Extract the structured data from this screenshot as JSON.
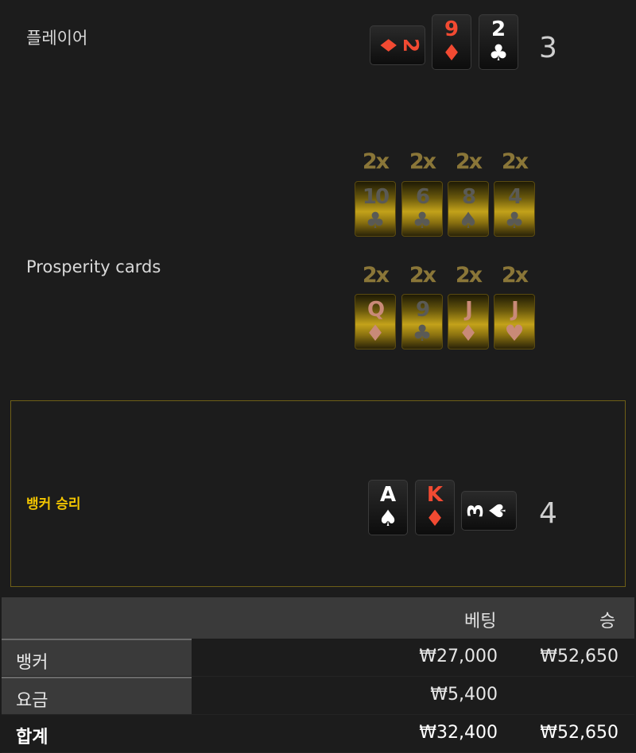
{
  "player": {
    "label": "플레이어",
    "score": "3",
    "cards": [
      {
        "rank": "2",
        "suit": "♦",
        "color": "red"
      },
      {
        "rank": "9",
        "suit": "♦",
        "color": "red"
      },
      {
        "rank": "2",
        "suit": "♣",
        "color": "black"
      }
    ]
  },
  "prosperity": {
    "label": "Prosperity cards",
    "row1": [
      {
        "mult": "2x",
        "rank": "10",
        "suit": "♣"
      },
      {
        "mult": "2x",
        "rank": "6",
        "suit": "♣"
      },
      {
        "mult": "2x",
        "rank": "8",
        "suit": "♠"
      },
      {
        "mult": "2x",
        "rank": "4",
        "suit": "♣"
      }
    ],
    "row2": [
      {
        "mult": "2x",
        "rank": "Q",
        "suit": "♦"
      },
      {
        "mult": "2x",
        "rank": "9",
        "suit": "♣"
      },
      {
        "mult": "2x",
        "rank": "J",
        "suit": "♦"
      },
      {
        "mult": "2x",
        "rank": "J",
        "suit": "♥"
      }
    ]
  },
  "banker": {
    "label": "뱅커 승리",
    "score": "4",
    "cards": [
      {
        "rank": "A",
        "suit": "♠",
        "color": "black"
      },
      {
        "rank": "K",
        "suit": "♦",
        "color": "red"
      },
      {
        "rank": "3",
        "suit": "♠",
        "color": "black"
      }
    ]
  },
  "table": {
    "headers": {
      "bet": "베팅",
      "win": "승"
    },
    "rows": [
      {
        "name": "뱅커",
        "bet": "₩27,000",
        "win": "₩52,650"
      },
      {
        "name": "요금",
        "bet": "₩5,400",
        "win": ""
      }
    ],
    "total": {
      "name": "합계",
      "bet": "₩32,400",
      "win": "₩52,650"
    }
  }
}
